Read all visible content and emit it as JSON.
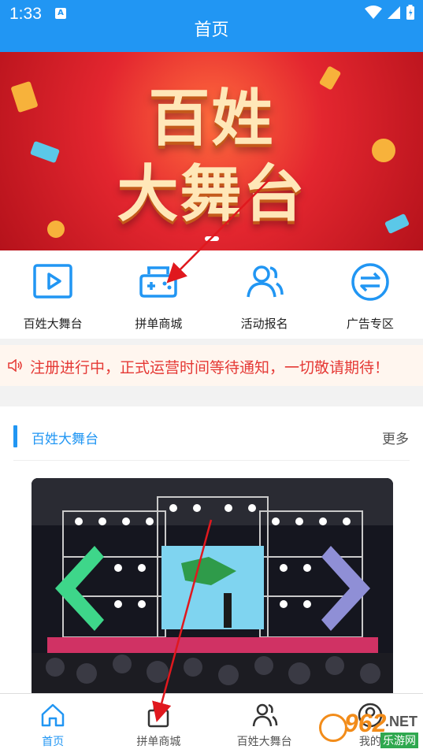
{
  "status_bar": {
    "time": "1:33"
  },
  "header": {
    "title": "首页"
  },
  "banner": {
    "line1": "百姓",
    "line2": "大舞台"
  },
  "quick_nav": [
    {
      "label": "百姓大舞台",
      "icon": "play-video-icon"
    },
    {
      "label": "拼单商城",
      "icon": "gamepad-icon"
    },
    {
      "label": "活动报名",
      "icon": "users-icon"
    },
    {
      "label": "广告专区",
      "icon": "exchange-icon"
    }
  ],
  "notice": {
    "text": "注册进行中，正式运营时间等待通知，一切敬请期待！",
    "icon": "speaker-icon"
  },
  "section": {
    "title": "百姓大舞台",
    "more": "更多"
  },
  "tabs": [
    {
      "label": "首页",
      "icon": "home-icon",
      "active": true
    },
    {
      "label": "拼单商城",
      "icon": "bag-icon",
      "active": false
    },
    {
      "label": "百姓大舞台",
      "icon": "users-icon",
      "active": false
    },
    {
      "label": "我的",
      "icon": "user-icon",
      "active": false
    }
  ],
  "watermark": {
    "num": "962",
    "net": ".NET",
    "cn": "乐游网"
  },
  "colors": {
    "primary": "#2196f3",
    "notice_text": "#e53935",
    "banner_bg": "#e3262f"
  }
}
